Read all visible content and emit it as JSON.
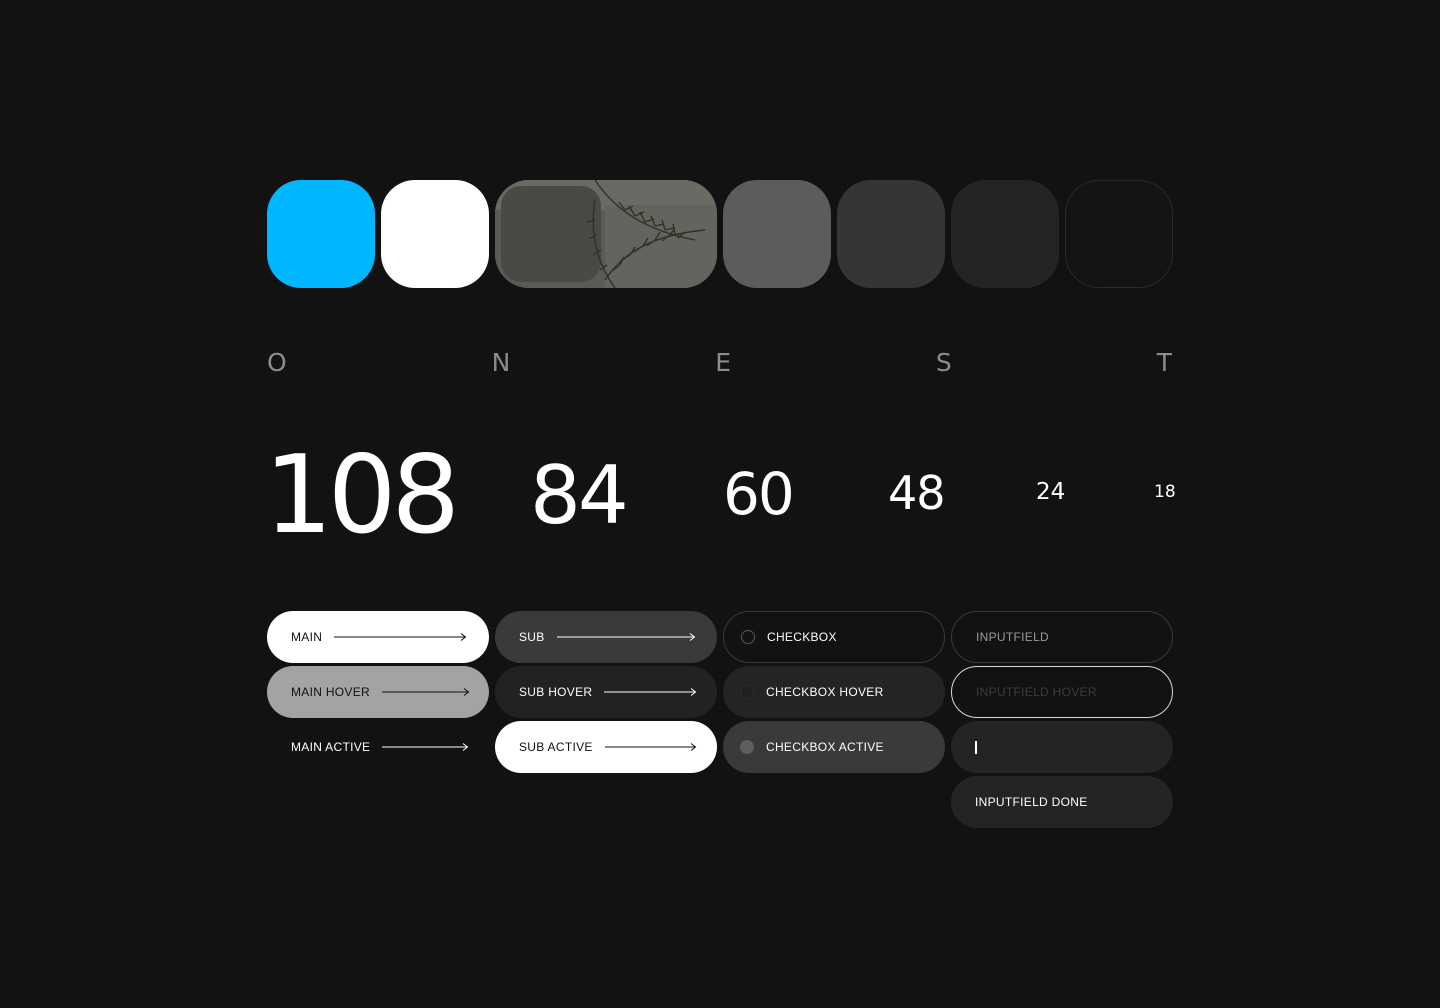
{
  "palette": {
    "accent": "#00b7ff",
    "white": "#ffffff",
    "gray_1": "#5c5c5c",
    "gray_2": "#353535",
    "gray_3": "#242424",
    "gray_4": "#141414",
    "background": "#121212"
  },
  "letters": [
    "O",
    "N",
    "E",
    "S",
    "T"
  ],
  "type_sizes": [
    "108",
    "84",
    "60",
    "48",
    "24",
    "18"
  ],
  "buttons": {
    "main": "MAIN",
    "main_hover": "MAIN HOVER",
    "main_active": "MAIN ACTIVE",
    "sub": "SUB",
    "sub_hover": "SUB HOVER",
    "sub_active": "SUB ACTIVE"
  },
  "checkboxes": {
    "default": "CHECKBOX",
    "hover": "CHECKBOX HOVER",
    "active": "CHECKBOX ACTIVE"
  },
  "inputs": {
    "default": "INPUTFIELD",
    "hover": "INPUTFIELD HOVER",
    "done": "INPUTFIELD DONE"
  }
}
